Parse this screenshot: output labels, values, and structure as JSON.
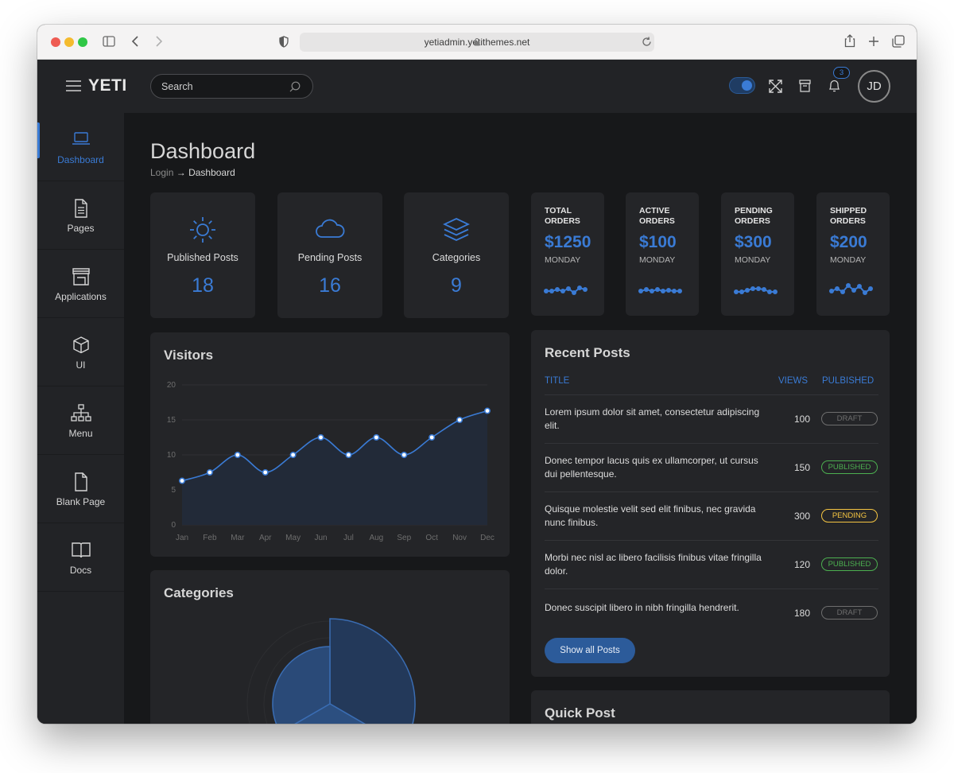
{
  "browser": {
    "url": "yetiadmin.yetithemes.net"
  },
  "topbar": {
    "brand": "YETI",
    "search_placeholder": "Search",
    "notification_count": "3",
    "avatar_initials": "JD"
  },
  "colors": {
    "accent": "#3a7bd5",
    "background": "#17181a",
    "card": "#242528",
    "published": "#4caf50",
    "pending": "#f5c542",
    "draft": "#6e6e6e"
  },
  "sidebar": {
    "items": [
      {
        "label": "Dashboard",
        "icon": "laptop-icon",
        "active": true
      },
      {
        "label": "Pages",
        "icon": "document-icon"
      },
      {
        "label": "Applications",
        "icon": "store-icon"
      },
      {
        "label": "UI",
        "icon": "cube-icon"
      },
      {
        "label": "Menu",
        "icon": "sitemap-icon"
      },
      {
        "label": "Blank Page",
        "icon": "blank-page-icon"
      },
      {
        "label": "Docs",
        "icon": "book-icon"
      }
    ]
  },
  "page": {
    "title": "Dashboard",
    "breadcrumb": {
      "parent": "Login",
      "current": "Dashboard"
    }
  },
  "stats": [
    {
      "label": "Published Posts",
      "value": "18",
      "icon": "sun-icon"
    },
    {
      "label": "Pending Posts",
      "value": "16",
      "icon": "cloud-icon"
    },
    {
      "label": "Categories",
      "value": "9",
      "icon": "layers-icon"
    }
  ],
  "orders": [
    {
      "title": "Total Orders",
      "value": "$1250",
      "day": "MONDAY"
    },
    {
      "title": "Active Orders",
      "value": "$100",
      "day": "MONDAY"
    },
    {
      "title": "Pending Orders",
      "value": "$300",
      "day": "MONDAY"
    },
    {
      "title": "Shipped Orders",
      "value": "$200",
      "day": "MONDAY"
    }
  ],
  "visitors": {
    "title": "Visitors"
  },
  "chart_data": {
    "type": "area",
    "title": "Visitors",
    "categories": [
      "Jan",
      "Feb",
      "Mar",
      "Apr",
      "May",
      "Jun",
      "Jul",
      "Aug",
      "Sep",
      "Oct",
      "Nov",
      "Dec"
    ],
    "values": [
      6.3,
      7.5,
      10,
      7.5,
      10,
      12.5,
      10,
      12.5,
      10,
      12.5,
      15,
      16.3
    ],
    "ylim": [
      0,
      20
    ],
    "yticks": [
      0,
      5,
      10,
      15,
      20
    ],
    "grid": true
  },
  "categories_card": {
    "title": "Categories"
  },
  "recent_posts": {
    "title": "Recent Posts",
    "columns": {
      "title": "TITLE",
      "views": "VIEWS",
      "status": "PULBISHED"
    },
    "rows": [
      {
        "title": "Lorem ipsum dolor sit amet, consectetur adipiscing elit.",
        "views": "100",
        "status": "DRAFT",
        "status_color": "#6e6e6e"
      },
      {
        "title": "Donec tempor lacus quis ex ullamcorper, ut cursus dui pellentesque.",
        "views": "150",
        "status": "PUBLISHED",
        "status_color": "#4caf50"
      },
      {
        "title": "Quisque molestie velit sed elit finibus, nec gravida nunc finibus.",
        "views": "300",
        "status": "PENDING",
        "status_color": "#f5c542"
      },
      {
        "title": "Morbi nec nisl ac libero facilisis finibus vitae fringilla dolor.",
        "views": "120",
        "status": "PUBLISHED",
        "status_color": "#4caf50"
      },
      {
        "title": "Donec suscipit libero in nibh fringilla hendrerit.",
        "views": "180",
        "status": "DRAFT",
        "status_color": "#6e6e6e"
      }
    ],
    "button": "Show all Posts"
  },
  "quick_post": {
    "title": "Quick Post"
  }
}
